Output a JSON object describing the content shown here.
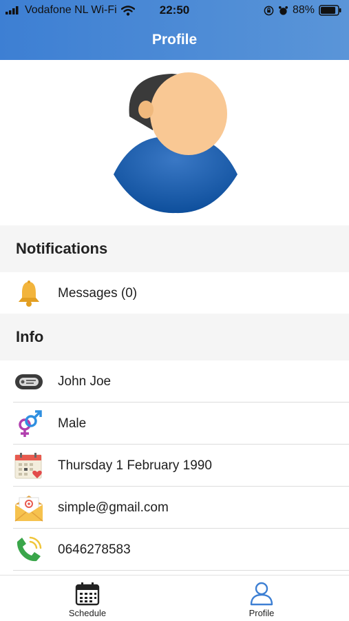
{
  "status_bar": {
    "carrier": "Vodafone NL Wi-Fi",
    "time": "22:50",
    "battery": "88%",
    "battery_level": 0.88
  },
  "nav": {
    "title": "Profile"
  },
  "avatar": {
    "icon": "user-avatar"
  },
  "notifications": {
    "title": "Notifications",
    "items": [
      {
        "icon": "bell-icon",
        "label": "Messages (0)"
      }
    ]
  },
  "info": {
    "title": "Info",
    "items": [
      {
        "icon": "name-tag-icon",
        "label": "John Joe"
      },
      {
        "icon": "gender-icon",
        "label": "Male"
      },
      {
        "icon": "calendar-heart-icon",
        "label": "Thursday 1 February 1990"
      },
      {
        "icon": "envelope-icon",
        "label": "simple@gmail.com"
      },
      {
        "icon": "phone-icon",
        "label": "0646278583"
      }
    ]
  },
  "tabbar": {
    "tabs": [
      {
        "label": "Schedule",
        "icon": "calendar-icon",
        "active": false
      },
      {
        "label": "Profile",
        "icon": "user-icon",
        "active": true
      }
    ]
  },
  "colors": {
    "header": "#4a88d6",
    "active_tab": "#3d7fd3",
    "inactive_tab": "#222222",
    "section_bg": "#f5f5f5"
  }
}
